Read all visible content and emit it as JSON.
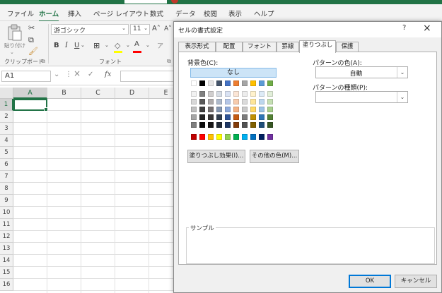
{
  "ribbon_tabs": [
    "ファイル",
    "ホーム",
    "挿入",
    "ページ レイアウト",
    "数式",
    "データ",
    "校閲",
    "表示",
    "ヘルプ"
  ],
  "active_tab": "ホーム",
  "ribbon": {
    "paste_label": "貼り付け",
    "clipboard_group": "クリップボード",
    "font_group": "フォント",
    "font_name": "游ゴシック",
    "font_size": "11",
    "bold": "B",
    "italic": "I",
    "underline": "U",
    "grow_font": "A",
    "shrink_font": "A"
  },
  "name_box": "A1",
  "fx_label": "fx",
  "columns": [
    "A",
    "B",
    "C",
    "D",
    "E"
  ],
  "rows": [
    "1",
    "2",
    "3",
    "4",
    "5",
    "6",
    "7",
    "8",
    "9",
    "10",
    "11",
    "12",
    "13",
    "14",
    "15",
    "16"
  ],
  "selected_cell": "A1",
  "dialog": {
    "title": "セルの書式設定",
    "help": "?",
    "close": "×",
    "tabs": [
      "表示形式",
      "配置",
      "フォント",
      "罫線",
      "塗りつぶし",
      "保護"
    ],
    "active_tab": "塗りつぶし",
    "background_color_label": "背景色(C):",
    "no_color_button": "なし",
    "fill_effects_button": "塗りつぶし効果(I)...",
    "more_colors_button": "その他の色(M)...",
    "pattern_color_label": "パターンの色(A):",
    "pattern_color_value": "自動",
    "pattern_style_label": "パターンの種類(P):",
    "pattern_style_value": "",
    "sample_label": "サンプル",
    "ok_button": "OK",
    "cancel_button": "キャンセル",
    "palette_row1": [
      "#ffffff",
      "#000000",
      "#e7e6e6",
      "#44546a",
      "#4472c4",
      "#ed7d31",
      "#a5a5a5",
      "#ffc000",
      "#5b9bd5",
      "#70ad47"
    ],
    "palette_tints": [
      [
        "#f2f2f2",
        "#808080",
        "#d0cece",
        "#d6dce4",
        "#d9e2f3",
        "#fbe5d5",
        "#ededed",
        "#fff2cc",
        "#ddebf7",
        "#e2efd9"
      ],
      [
        "#d8d8d8",
        "#595959",
        "#aeabab",
        "#adb9ca",
        "#b4c6e7",
        "#f7cbac",
        "#dbdbdb",
        "#fee599",
        "#bdd7ee",
        "#c5e0b3"
      ],
      [
        "#bfbfbf",
        "#3f3f3f",
        "#757070",
        "#8496b0",
        "#8eaadb",
        "#f4b183",
        "#c9c9c9",
        "#ffd965",
        "#9cc3e5",
        "#a8d08d"
      ],
      [
        "#a5a5a5",
        "#262626",
        "#3a3838",
        "#323f4f",
        "#2f5496",
        "#c55a11",
        "#7b7b7b",
        "#bf9000",
        "#2e75b5",
        "#538135"
      ],
      [
        "#7f7f7f",
        "#0c0c0c",
        "#171616",
        "#222a35",
        "#1f3864",
        "#833c0b",
        "#525252",
        "#7f6000",
        "#1f4e79",
        "#375623"
      ]
    ],
    "palette_standard": [
      "#c00000",
      "#ff0000",
      "#ffc000",
      "#ffff00",
      "#92d050",
      "#00b050",
      "#00b0f0",
      "#0070c0",
      "#002060",
      "#7030a0"
    ]
  }
}
